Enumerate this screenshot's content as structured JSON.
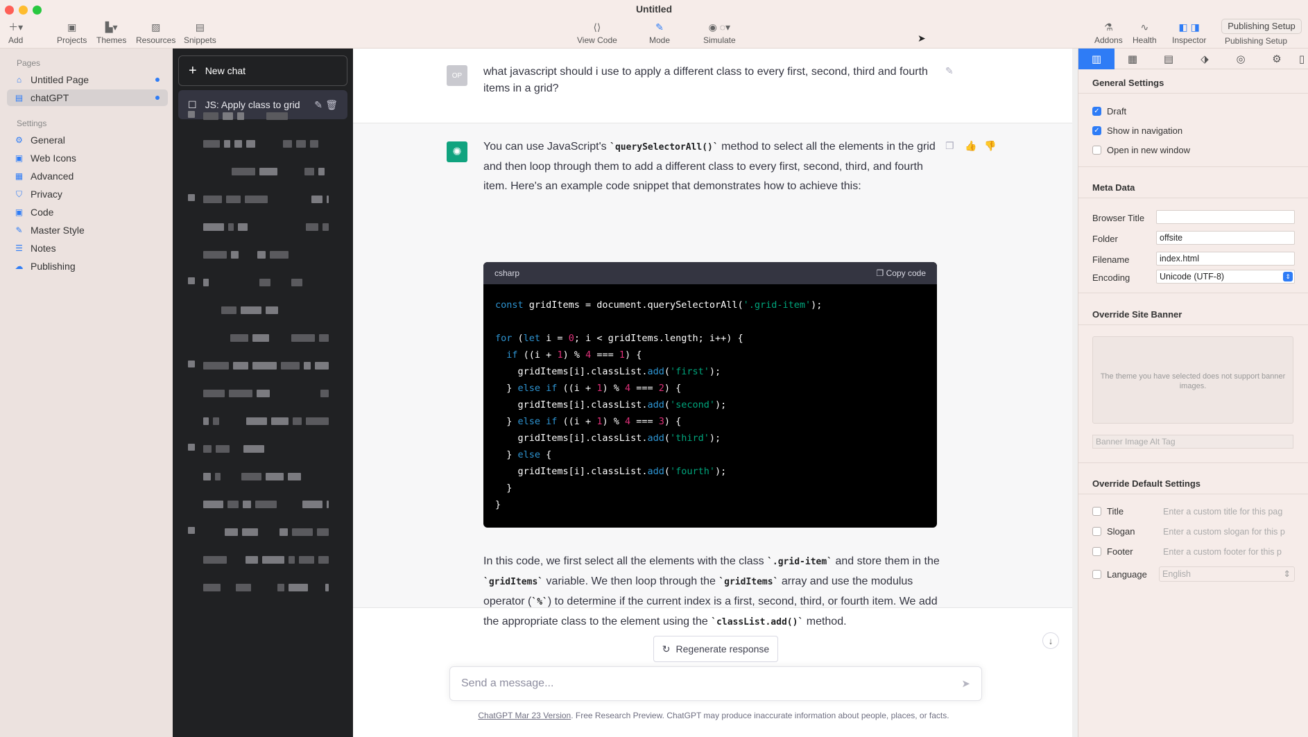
{
  "window": {
    "title": "Untitled"
  },
  "toolbar": {
    "left": [
      {
        "label": "Add",
        "icon": "plus-icon"
      },
      {
        "label": "Projects",
        "icon": "box-icon"
      },
      {
        "label": "Themes",
        "icon": "brush-icon"
      },
      {
        "label": "Resources",
        "icon": "image-icon"
      },
      {
        "label": "Snippets",
        "icon": "snippet-icon"
      }
    ],
    "center": [
      {
        "label": "View Code",
        "icon": "code-icon"
      },
      {
        "label": "Mode",
        "icon": "pencil-icon"
      },
      {
        "label": "Simulate",
        "icon": "eye-icon"
      }
    ],
    "simulate_label": "Simulate",
    "right": [
      {
        "label": "Addons",
        "icon": "flask-icon"
      },
      {
        "label": "Health",
        "icon": "pulse-icon"
      },
      {
        "label": "Inspector",
        "icon": "panel-left-icon"
      },
      {
        "label": "Publishing Setup",
        "icon": "panel-right-icon"
      }
    ],
    "publishing_setup_button": "Publishing Setup"
  },
  "sidebar": {
    "pages_heading": "Pages",
    "pages": [
      {
        "label": "Untitled Page",
        "icon": "home-icon"
      },
      {
        "label": "chatGPT",
        "icon": "page-icon"
      }
    ],
    "settings_heading": "Settings",
    "settings": [
      {
        "label": "General",
        "icon": "gear-icon"
      },
      {
        "label": "Web Icons",
        "icon": "web-icon"
      },
      {
        "label": "Advanced",
        "icon": "advanced-icon"
      },
      {
        "label": "Privacy",
        "icon": "shield-icon"
      },
      {
        "label": "Code",
        "icon": "code-icon"
      },
      {
        "label": "Master Style",
        "icon": "wand-icon"
      },
      {
        "label": "Notes",
        "icon": "notes-icon"
      },
      {
        "label": "Publishing",
        "icon": "cloud-icon"
      }
    ]
  },
  "chat_sidebar": {
    "new_chat": "New chat",
    "active_chat": "JS: Apply class to grid"
  },
  "chat": {
    "user_avatar": "OP",
    "question": "what javascript should i use to apply a different class to every first, second, third and fourth items in a grid?",
    "answer_intro_1": "You can use JavaScript's",
    "answer_code_1": "`querySelectorAll()`",
    "answer_intro_2": "method to select all the elements in the grid and then loop through them to add a different class to every first, second, third, and fourth item. Here's an example code snippet that demonstrates how to achieve this:",
    "code_lang": "csharp",
    "copy_code": "Copy code",
    "explain_1": "In this code, we first select all the elements with the class",
    "explain_code_1": "`.grid-item`",
    "explain_2": "and store them in the",
    "explain_code_2": "`gridItems`",
    "explain_3": "variable. We then loop through the",
    "explain_code_3": "`gridItems`",
    "explain_4": "array and use the modulus operator (",
    "explain_code_4": "`%`",
    "explain_5": ") to determine if the current index is a first, second, third, or fourth item. We add the appropriate class to the element using the",
    "explain_code_5": "`classList.add()`",
    "explain_6": "method.",
    "regenerate": "Regenerate response",
    "input_placeholder": "Send a message...",
    "footer_link": "ChatGPT Mar 23 Version",
    "footer_text": ". Free Research Preview. ChatGPT may produce inaccurate information about people, places, or facts."
  },
  "inspector": {
    "general_heading": "General Settings",
    "draft": "Draft",
    "show_in_nav": "Show in navigation",
    "open_new_window": "Open in new window",
    "meta_heading": "Meta Data",
    "browser_title_label": "Browser Title",
    "browser_title_value": "",
    "folder_label": "Folder",
    "folder_value": "offsite",
    "filename_label": "Filename",
    "filename_value": "index.html",
    "encoding_label": "Encoding",
    "encoding_value": "Unicode (UTF-8)",
    "banner_heading": "Override Site Banner",
    "banner_msg": "The theme you have selected does not support banner images.",
    "banner_alt_placeholder": "Banner Image Alt Tag",
    "defaults_heading": "Override Default Settings",
    "title_label": "Title",
    "title_placeholder": "Enter a custom title for this pag",
    "slogan_label": "Slogan",
    "slogan_placeholder": "Enter a custom slogan for this p",
    "footer_label": "Footer",
    "footer_placeholder": "Enter a custom footer for this p",
    "language_label": "Language",
    "language_value": "English"
  }
}
